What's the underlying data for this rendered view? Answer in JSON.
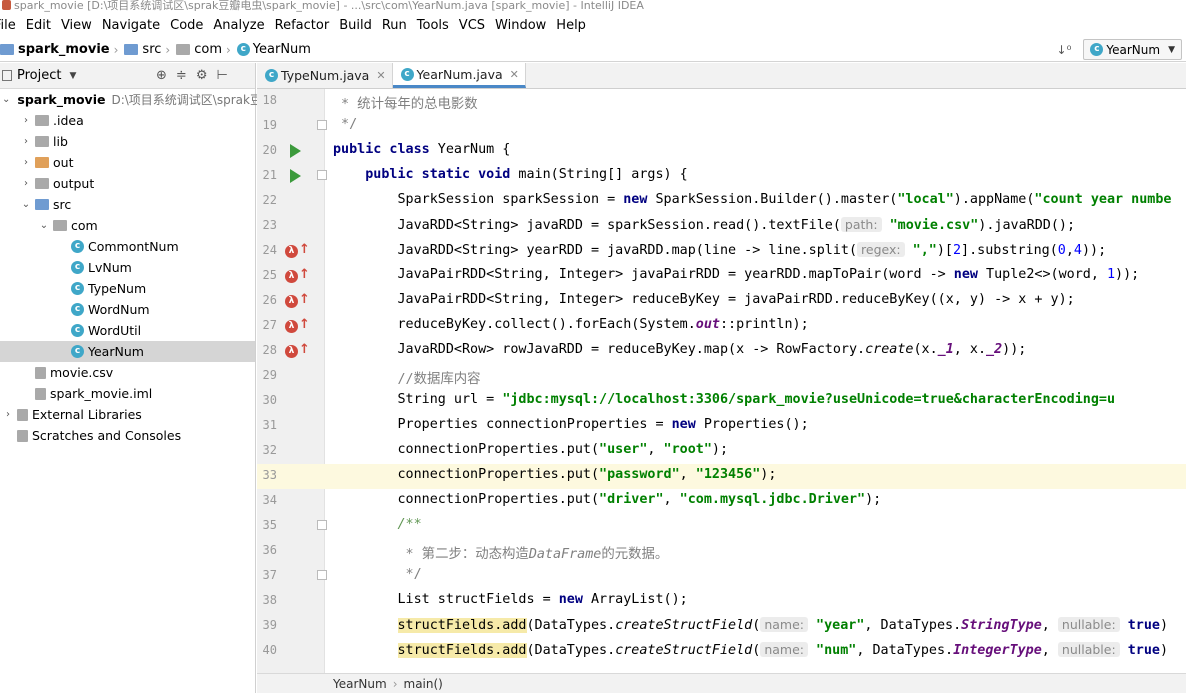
{
  "window": {
    "title": "spark_movie [D:\\项目系统调试区\\sprak豆瓣电虫\\spark_movie] - ...\\src\\com\\YearNum.java [spark_movie] - IntelliJ IDEA"
  },
  "menu": [
    "File",
    "Edit",
    "View",
    "Navigate",
    "Code",
    "Analyze",
    "Refactor",
    "Build",
    "Run",
    "Tools",
    "VCS",
    "Window",
    "Help"
  ],
  "navbar": {
    "crumbs": [
      "spark_movie",
      "src",
      "com",
      "YearNum"
    ],
    "run_config": "YearNum"
  },
  "project_panel": {
    "header": "Project",
    "tree": [
      {
        "label": "spark_movie",
        "path": "D:\\项目系统调试区\\sprak豆",
        "depth": 0,
        "arrow": "down",
        "icon": "folder-blue",
        "bold": true
      },
      {
        "label": ".idea",
        "depth": 1,
        "arrow": "right",
        "icon": "folder-gray"
      },
      {
        "label": "lib",
        "depth": 1,
        "arrow": "right",
        "icon": "folder-gray"
      },
      {
        "label": "out",
        "depth": 1,
        "arrow": "right",
        "icon": "folder-orange"
      },
      {
        "label": "output",
        "depth": 1,
        "arrow": "right",
        "icon": "folder-gray"
      },
      {
        "label": "src",
        "depth": 1,
        "arrow": "down",
        "icon": "folder-blue"
      },
      {
        "label": "com",
        "depth": 2,
        "arrow": "down",
        "icon": "folder-gray"
      },
      {
        "label": "CommontNum",
        "depth": 3,
        "arrow": "",
        "icon": "class"
      },
      {
        "label": "LvNum",
        "depth": 3,
        "arrow": "",
        "icon": "class"
      },
      {
        "label": "TypeNum",
        "depth": 3,
        "arrow": "",
        "icon": "class"
      },
      {
        "label": "WordNum",
        "depth": 3,
        "arrow": "",
        "icon": "class"
      },
      {
        "label": "WordUtil",
        "depth": 3,
        "arrow": "",
        "icon": "class"
      },
      {
        "label": "YearNum",
        "depth": 3,
        "arrow": "",
        "icon": "class",
        "selected": true
      },
      {
        "label": "movie.csv",
        "depth": 1,
        "arrow": "",
        "icon": "file"
      },
      {
        "label": "spark_movie.iml",
        "depth": 1,
        "arrow": "",
        "icon": "file"
      },
      {
        "label": "External Libraries",
        "depth": 0,
        "arrow": "right",
        "icon": "libs"
      },
      {
        "label": "Scratches and Consoles",
        "depth": 0,
        "arrow": "",
        "icon": "scratch"
      }
    ]
  },
  "tabs": [
    {
      "label": "TypeNum.java",
      "active": false
    },
    {
      "label": "YearNum.java",
      "active": true
    }
  ],
  "editor": {
    "line_numbers": [
      "18",
      "19",
      "20",
      "21",
      "22",
      "23",
      "24",
      "25",
      "26",
      "27",
      "28",
      "29",
      "30",
      "31",
      "32",
      "33",
      "34",
      "35",
      "36",
      "37",
      "38",
      "39",
      "40"
    ],
    "lines": {
      "l18": " * 统计每年的总电影数",
      "l19": " */",
      "l20_kw": "public class",
      "l20_rest": " YearNum {",
      "l21_kw": "    public static void",
      "l21_rest": " main(String[] args) {",
      "l22_a": "        SparkSession sparkSession = ",
      "l22_new": "new",
      "l22_b": " SparkSession.Builder().master(",
      "l22_s1": "\"local\"",
      "l22_c": ").appName(",
      "l22_s2": "\"count year numbe",
      "l23_a": "        JavaRDD<String> javaRDD = sparkSession.read().textFile(",
      "l23_hint": "path:",
      "l23_s": "\"movie.csv\"",
      "l23_b": ").javaRDD();",
      "l24_a": "        JavaRDD<String> yearRDD = javaRDD.map(line -> line.split(",
      "l24_hint": "regex:",
      "l24_s": "\",\"",
      "l24_b": ")[",
      "l24_n1": "2",
      "l24_c": "].substring(",
      "l24_n2": "0",
      "l24_d": ",",
      "l24_n3": "4",
      "l24_e": "));",
      "l25_a": "        JavaPairRDD<String, Integer> javaPairRDD = yearRDD.mapToPair(word -> ",
      "l25_new": "new",
      "l25_b": " Tuple2<>(word, ",
      "l25_n": "1",
      "l25_c": "));",
      "l26": "        JavaPairRDD<String, Integer> reduceByKey = javaPairRDD.reduceByKey((x, y) -> x + y);",
      "l27_a": "        reduceByKey.collect().forEach(System.",
      "l27_f": "out",
      "l27_b": "::println);",
      "l28_a": "        JavaRDD<Row> rowJavaRDD = reduceByKey.map(x -> RowFactory.",
      "l28_i": "create",
      "l28_b": "(x.",
      "l28_f1": "_1",
      "l28_c": ", x.",
      "l28_f2": "_2",
      "l28_d": "));",
      "l29": "        //数据库内容",
      "l30_a": "        String url = ",
      "l30_s": "\"jdbc:mysql://localhost:3306/spark_movie?useUnicode=true&characterEncoding=u",
      "l31_a": "        Properties connectionProperties = ",
      "l31_new": "new",
      "l31_b": " Properties();",
      "l32_a": "        connectionProperties.put(",
      "l32_s1": "\"user\"",
      "l32_b": ", ",
      "l32_s2": "\"root\"",
      "l32_c": ");",
      "l33_a": "        connectionProperties.put(",
      "l33_s1": "\"password\"",
      "l33_b": ", ",
      "l33_s2": "\"123456\"",
      "l33_c": ");",
      "l34_a": "        connectionProperties.put(",
      "l34_s1": "\"driver\"",
      "l34_b": ", ",
      "l34_s2": "\"com.mysql.jdbc.Driver\"",
      "l34_c": ");",
      "l35": "        /**",
      "l36_a": "         * 第二步：动态构造",
      "l36_i": "DataFrame",
      "l36_b": "的元数据。",
      "l37": "         */",
      "l38_a": "        List structFields = ",
      "l38_new": "new",
      "l38_b": " ArrayList();",
      "l39_pre": "        ",
      "l39_hl": "structFields.add",
      "l39_a": "(DataTypes.",
      "l39_i": "createStructField",
      "l39_b": "(",
      "l39_hint1": "name:",
      "l39_s": "\"year\"",
      "l39_c": ", DataTypes.",
      "l39_f": "StringType",
      "l39_d": ", ",
      "l39_hint2": "nullable:",
      "l39_t": "true",
      "l39_e": ")",
      "l40_pre": "        ",
      "l40_hl": "structFields.add",
      "l40_a": "(DataTypes.",
      "l40_i": "createStructField",
      "l40_b": "(",
      "l40_hint1": "name:",
      "l40_s": "\"num\"",
      "l40_c": ", DataTypes.",
      "l40_f": "IntegerType",
      "l40_d": ", ",
      "l40_hint2": "nullable:",
      "l40_t": "true",
      "l40_e": ")"
    },
    "current_line": "33"
  },
  "bottom_breadcrumb": [
    "YearNum",
    "main()"
  ],
  "colors": {
    "keyword": "#000080",
    "string": "#008000",
    "comment": "#808080",
    "run_gutter": "#3c9a3c",
    "lambda_gutter": "#d0493d",
    "tab_underline": "#4a88c7"
  }
}
